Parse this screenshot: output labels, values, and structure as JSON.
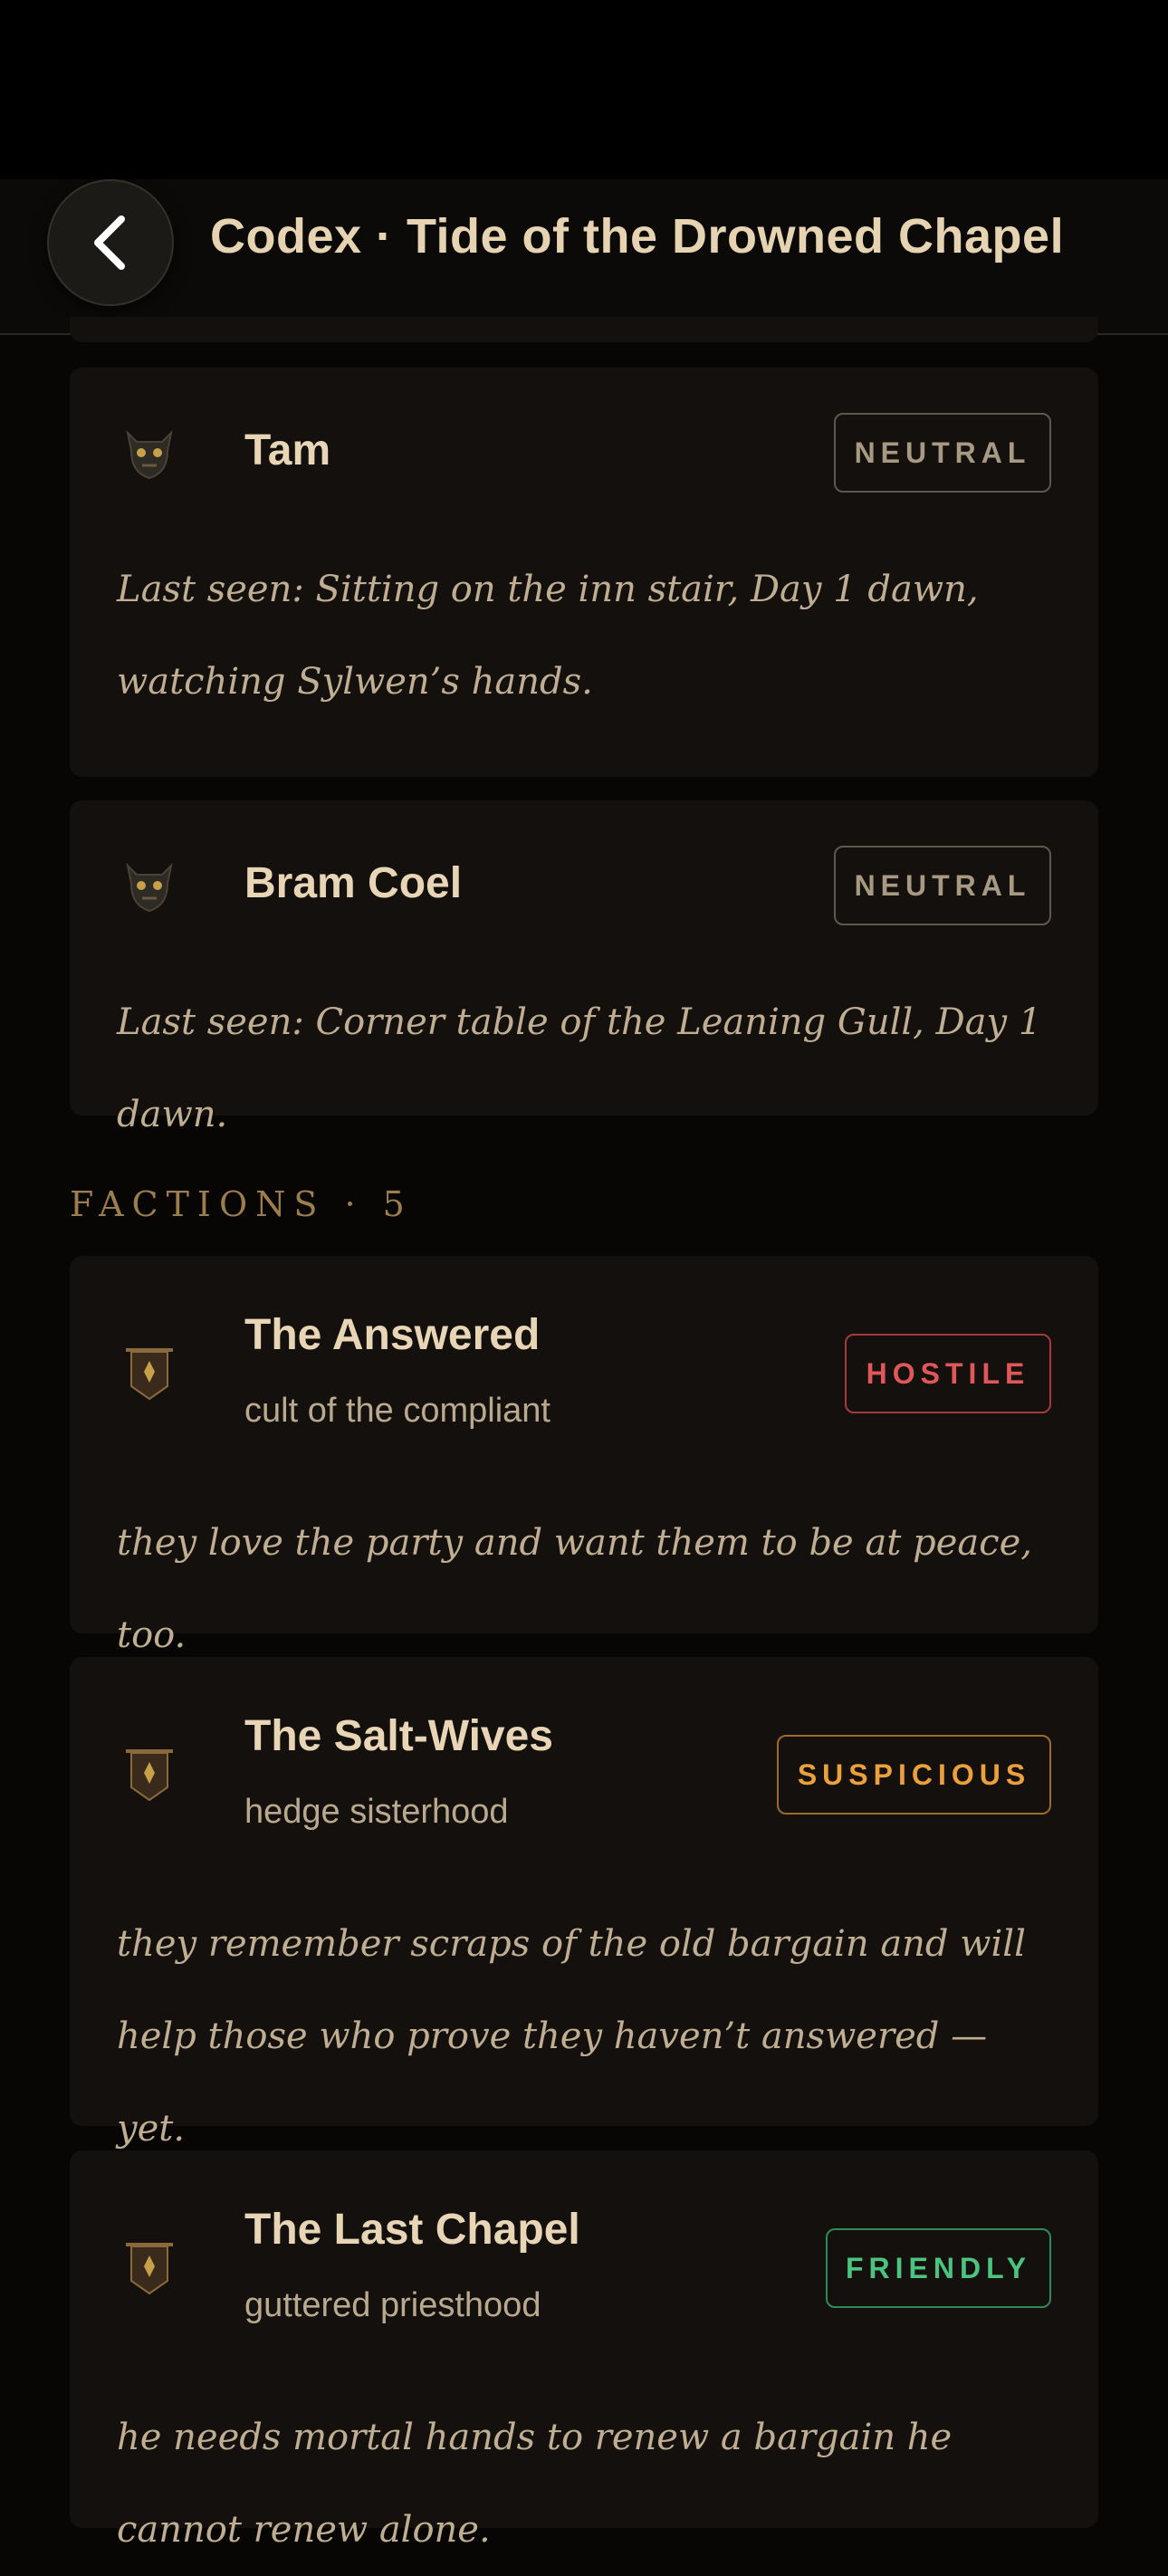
{
  "header": {
    "title": "Codex · Tide of the Drowned Chapel",
    "back_icon": "chevron-left-icon"
  },
  "npcs": [
    {
      "name": "Tam",
      "status": "NEUTRAL",
      "icon": "demon-mask-icon",
      "last_seen": "Last seen: Sitting on the inn stair, Day 1 dawn, watching Sylwen’s hands."
    },
    {
      "name": "Bram Coel",
      "status": "NEUTRAL",
      "icon": "demon-mask-icon",
      "last_seen": "Last seen: Corner table of the Leaning Gull, Day 1 dawn."
    }
  ],
  "factions_section": {
    "label": "FACTIONS · 5"
  },
  "factions": [
    {
      "name": "The Answered",
      "kind": "cult of the compliant",
      "status": "HOSTILE",
      "icon": "banner-icon",
      "note": "they love the party and want them to be at peace, too."
    },
    {
      "name": "The Salt-Wives",
      "kind": "hedge sisterhood",
      "status": "SUSPICIOUS",
      "icon": "banner-icon",
      "note": "they remember scraps of the old bargain and will help those who prove they haven’t answered — yet."
    },
    {
      "name": "The Last Chapel",
      "kind": "guttered priesthood",
      "status": "FRIENDLY",
      "icon": "banner-icon",
      "note": "he needs mortal hands to renew a bargain he cannot renew alone."
    }
  ],
  "colors": {
    "background": "#070605",
    "card": "#14100d",
    "accent": "#9c7d4d",
    "neutral": "#a89a82",
    "hostile": "#e0575a",
    "suspicious": "#eba03c",
    "friendly": "#4cc37e"
  }
}
